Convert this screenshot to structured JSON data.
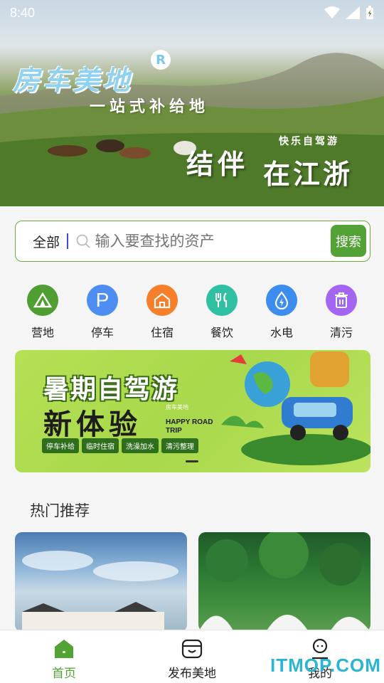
{
  "status_bar": {
    "time": "8:40"
  },
  "hero": {
    "title": "房车美地",
    "reg_mark": "R",
    "subtitle": "一站式补给地",
    "tagline": "快乐自驾游",
    "slogan_part1": "结伴",
    "slogan_part2": "在江浙"
  },
  "search": {
    "scope": "全部",
    "placeholder": "输入要查找的资产",
    "button": "搜索"
  },
  "categories": [
    {
      "label": "营地",
      "icon": "camp-tent-icon",
      "color": "#4f9e32"
    },
    {
      "label": "停车",
      "icon": "parking-icon",
      "color": "#4e8ef2"
    },
    {
      "label": "住宿",
      "icon": "house-icon",
      "color": "#f77f2a"
    },
    {
      "label": "餐饮",
      "icon": "fork-knife-icon",
      "color": "#2ec0a0"
    },
    {
      "label": "水电",
      "icon": "water-power-icon",
      "color": "#3d8df0"
    },
    {
      "label": "清污",
      "icon": "trash-icon",
      "color": "#a466f0"
    }
  ],
  "banner": {
    "title_line1": "暑期自驾游",
    "title_line2": "新体验",
    "brand": "房车美地",
    "english": "HAPPY ROAD TRIP",
    "tags": [
      "停车补给",
      "临时住宿",
      "洗澡加水",
      "清污整理"
    ]
  },
  "section": {
    "title": "热门推荐"
  },
  "tabs": [
    {
      "label": "首页",
      "icon": "home-icon",
      "active": true
    },
    {
      "label": "发布美地",
      "icon": "publish-icon",
      "active": false
    },
    {
      "label": "我的",
      "icon": "profile-icon",
      "active": false
    }
  ],
  "watermark": "ITMOP.COM",
  "colors": {
    "accent": "#53a236",
    "banner_bg": "#b2dd50"
  }
}
